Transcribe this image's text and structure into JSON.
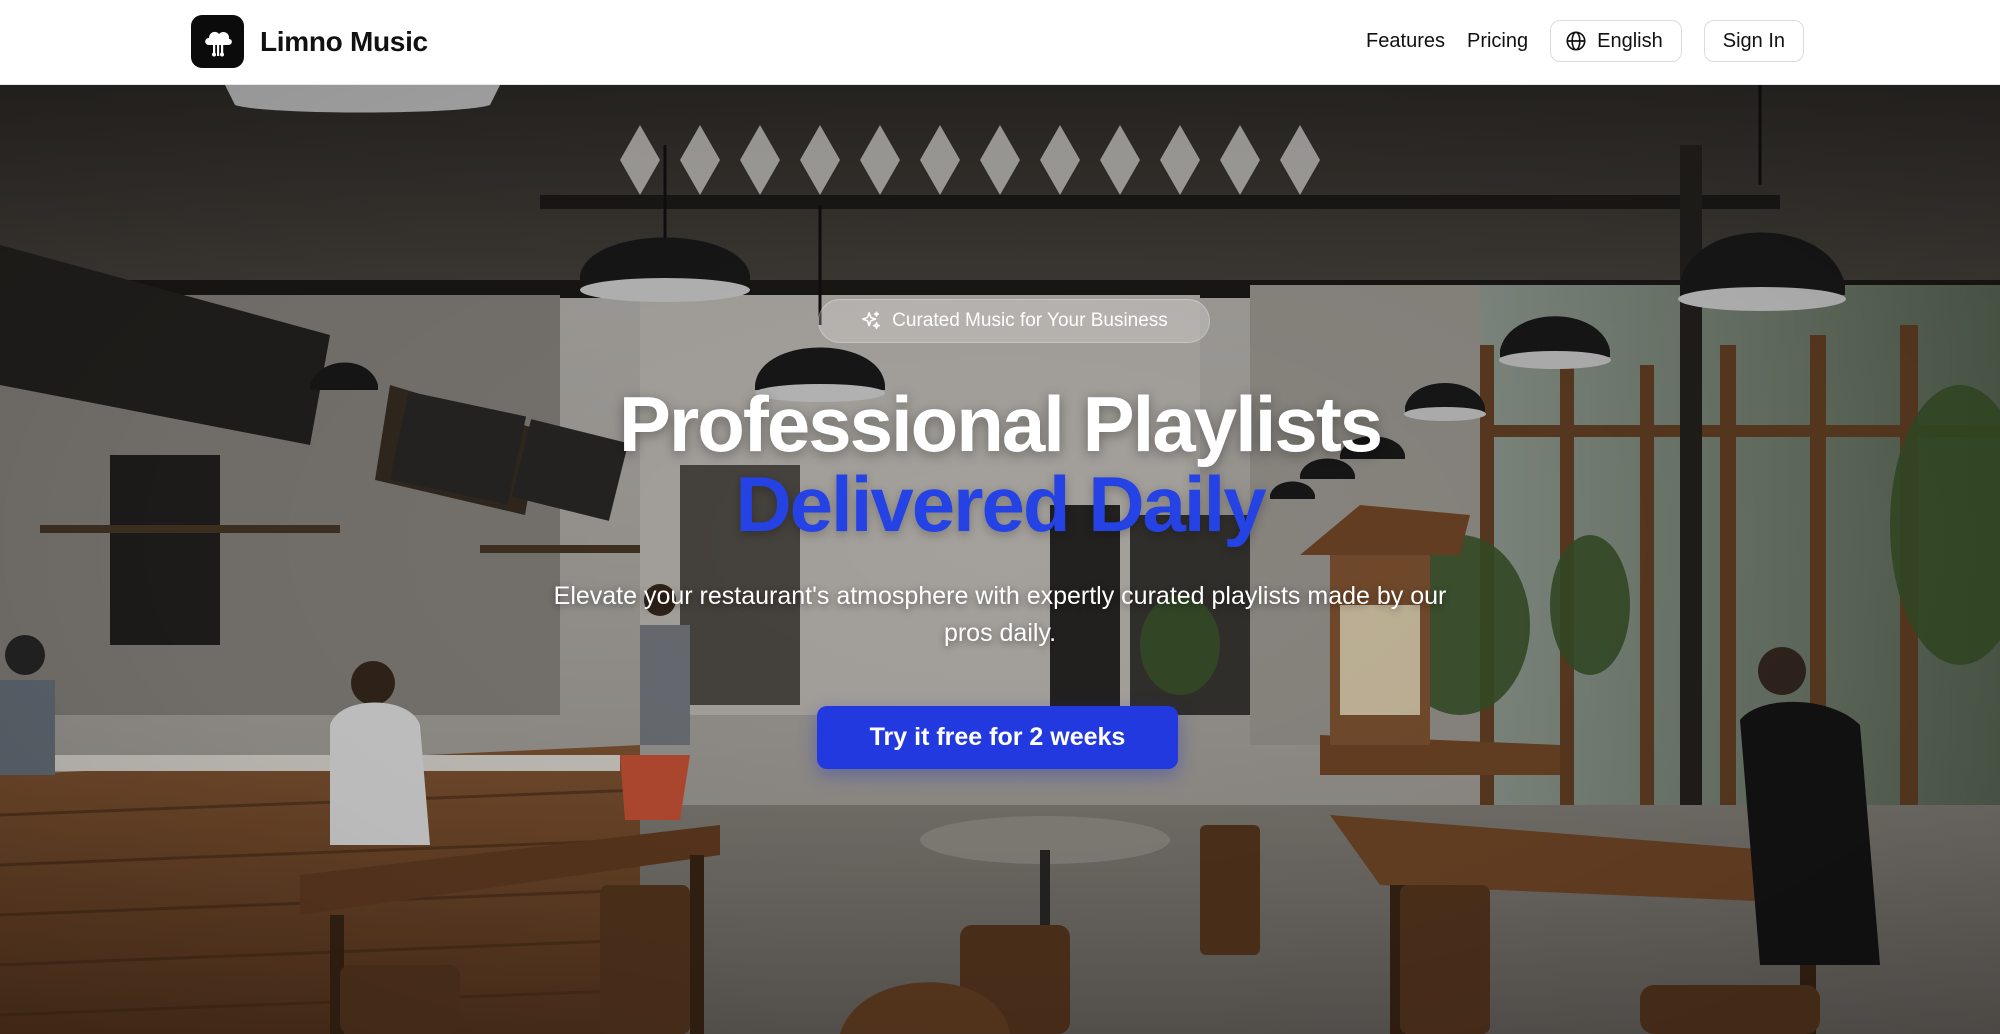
{
  "header": {
    "brand_name": "Limno Music",
    "logo_icon": "cloud-music-icon",
    "nav": {
      "features_label": "Features",
      "pricing_label": "Pricing",
      "language_label": "English",
      "language_icon": "globe-icon",
      "signin_label": "Sign In"
    }
  },
  "hero": {
    "background_image": "restaurant-interior-photo",
    "badge_icon": "sparkle-icon",
    "badge_label": "Curated Music for Your Business",
    "headline_line1": "Professional Playlists",
    "headline_line2": "Delivered Daily",
    "subtitle": "Elevate your restaurant's atmosphere with expertly curated playlists made by our pros daily.",
    "cta_label": "Try it free for 2 weeks"
  },
  "colors": {
    "accent_blue": "#2339e0",
    "headline_blue": "#2543e4",
    "logo_bg": "#0b0b0b"
  }
}
